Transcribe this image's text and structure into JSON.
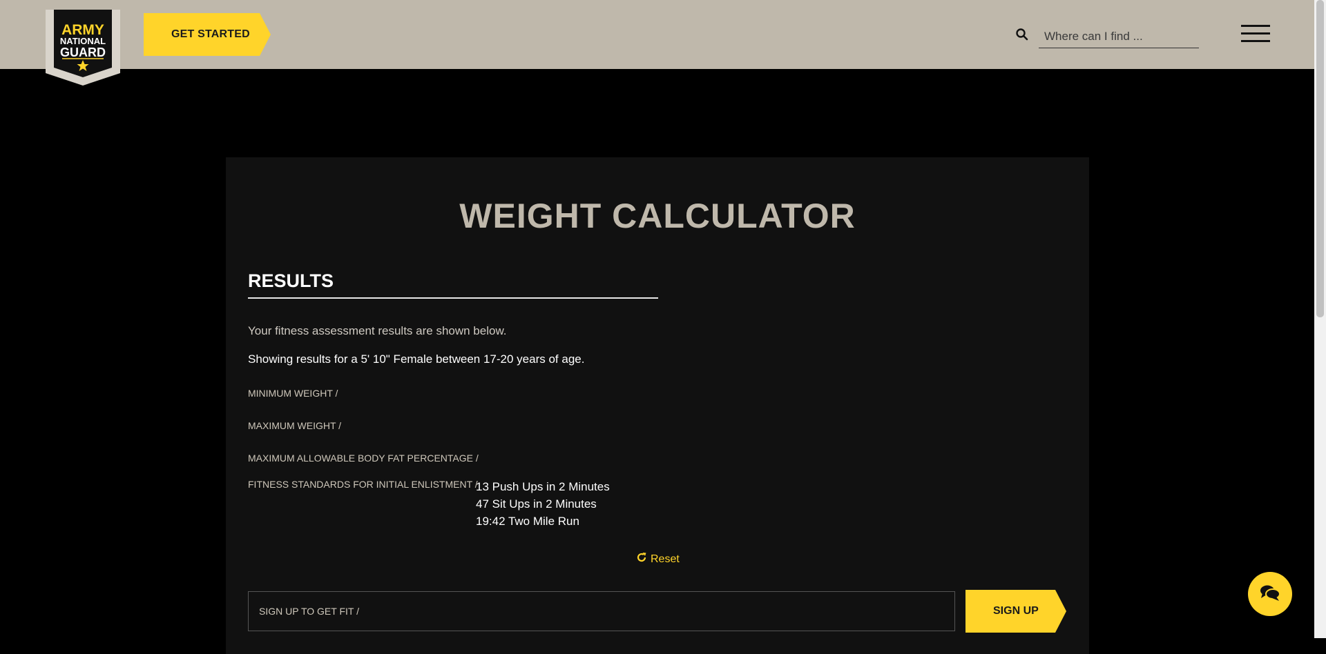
{
  "header": {
    "logo_text": [
      "ARMY",
      "NATIONAL",
      "GUARD"
    ],
    "get_started_label": "GET STARTED",
    "search_placeholder": "Where can I find ..."
  },
  "main": {
    "title": "WEIGHT CALCULATOR",
    "results_heading": "RESULTS",
    "intro_text": "Your fitness assessment results are shown below.",
    "showing_text": "Showing results for a 5' 10\" Female between 17-20 years of age.",
    "labels": {
      "min_weight": "MINIMUM WEIGHT /",
      "max_weight": "MAXIMUM WEIGHT /",
      "max_body_fat": "MAXIMUM ALLOWABLE BODY FAT PERCENTAGE /",
      "fitness_standards": "FITNESS STANDARDS FOR INITIAL ENLISTMENT /"
    },
    "fitness_standards": [
      "13 Push Ups in 2 Minutes",
      "47 Sit Ups in 2 Minutes",
      "19:42 Two Mile Run"
    ],
    "reset_label": "Reset",
    "signup_placeholder": "SIGN UP TO GET FIT /",
    "signup_button_label": "SIGN UP"
  },
  "colors": {
    "header_bg": "#bfb8ab",
    "accent_yellow": "#ffd42a",
    "card_bg": "#111111",
    "page_bg": "#000000"
  },
  "icons": {
    "search": "search-icon",
    "menu": "hamburger-menu-icon",
    "reset": "reset-icon",
    "chat": "chat-icon"
  }
}
